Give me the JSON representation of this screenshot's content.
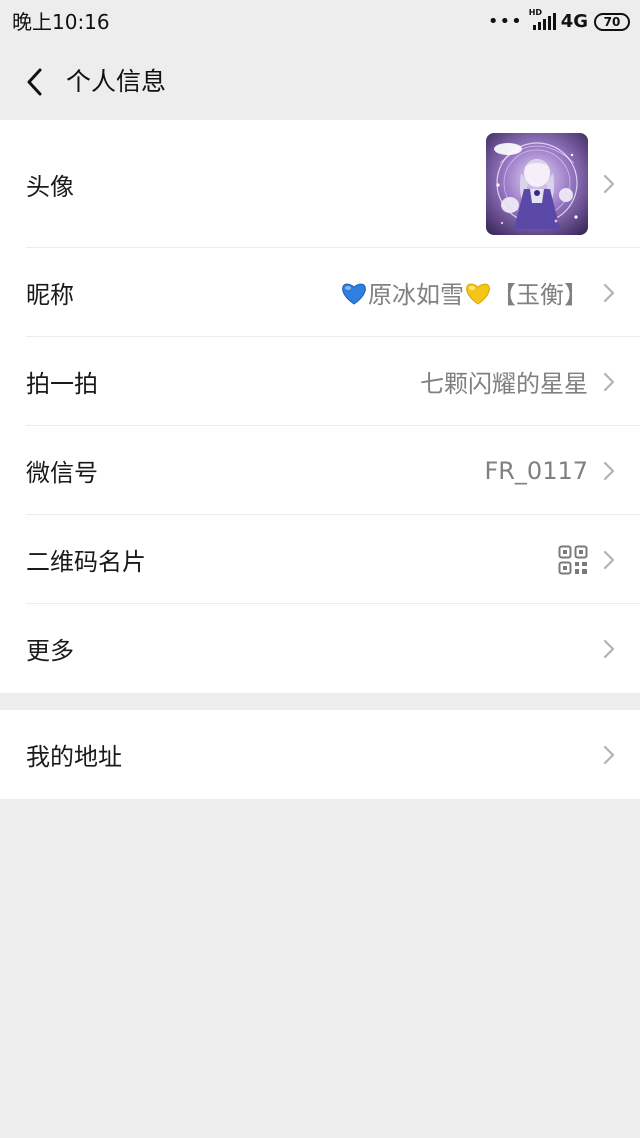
{
  "status_bar": {
    "time": "晚上10:16",
    "signal_hd": "HD",
    "network": "4G",
    "battery": "70"
  },
  "header": {
    "title": "个人信息"
  },
  "profile": {
    "avatar_label": "头像",
    "nickname_label": "昵称",
    "nickname_text": "原冰如雪",
    "nickname_suffix": "【玉衡】",
    "pat_label": "拍一拍",
    "pat_value": "七颗闪耀的星星",
    "wechat_id_label": "微信号",
    "wechat_id_value": "FR_0117",
    "qr_label": "二维码名片",
    "more_label": "更多"
  },
  "address": {
    "label": "我的地址"
  },
  "colors": {
    "background": "#ededed",
    "card": "#ffffff",
    "primary_text": "#1a1a1a",
    "secondary_text": "#808080",
    "heart_blue": "#2f7fe0",
    "heart_yellow": "#f5c518"
  }
}
